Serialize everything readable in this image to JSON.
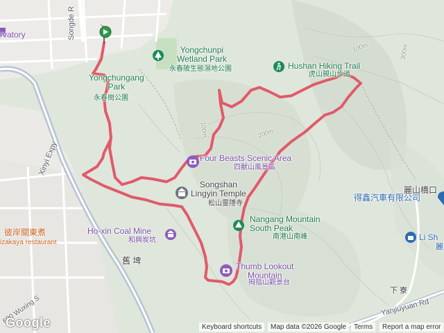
{
  "map": {
    "colors": {
      "route": "#e15a6a",
      "terrain": "#dfe6dc",
      "urban": "#ecebe8",
      "road": "#ffffff",
      "highway": "#b8c4d2",
      "park": "#c8e0c2"
    }
  },
  "labels": {
    "yongchunpi": "Yongchunpi\nWetland Park",
    "yongchunpi_zh": "永春陂生態濕地公園",
    "yongchungang": "Yongchungang\nPark",
    "yongchungang_zh": "永春崗公園",
    "hushan": "Hushan Hiking Trail",
    "hushan_zh": "虎山親山步道",
    "four_beasts": "Four Beasts Scenic Area",
    "four_beasts_zh": "四獸山風景區",
    "songshan": "Songshan\nLingyin Temple",
    "songshan_zh": "松山靈隱寺",
    "hoxin": "Ho-xin Coal Mine",
    "hoxin_zh": "和興炭坑",
    "nangang": "Nangang Mountain\nSouth Peak",
    "nangang_zh": "南港山南峰",
    "thumb": "Thumb Lookout\nMountain",
    "thumb_zh": "拇指山觀景台",
    "restaurant_zh": "彼岸關東煮",
    "restaurant": "izakaya restaurant",
    "store_zh": "得鑫汽車有限公司",
    "bridge_zh": "麗山橋口",
    "li_sh": "Li Sh",
    "li_zh": "麗",
    "observatory": "rvatory",
    "songde": "Songde R",
    "xinyi_expy": "Xinyi Expy",
    "jiu_kun": "舊  埤",
    "xia_liao": "下  寮",
    "yanjiuyuan": "Yanjiuyuan Rd",
    "wuxing": "600 Wuxing S",
    "contour_100a": "100m",
    "contour_200": "200m",
    "contour_100b": "100m",
    "contour_300": "300m"
  },
  "footer": {
    "google": "Google",
    "shortcuts": "Keyboard shortcuts",
    "mapdata": "Map data ©2026 Google",
    "terms": "Terms",
    "report": "Report a map error"
  }
}
